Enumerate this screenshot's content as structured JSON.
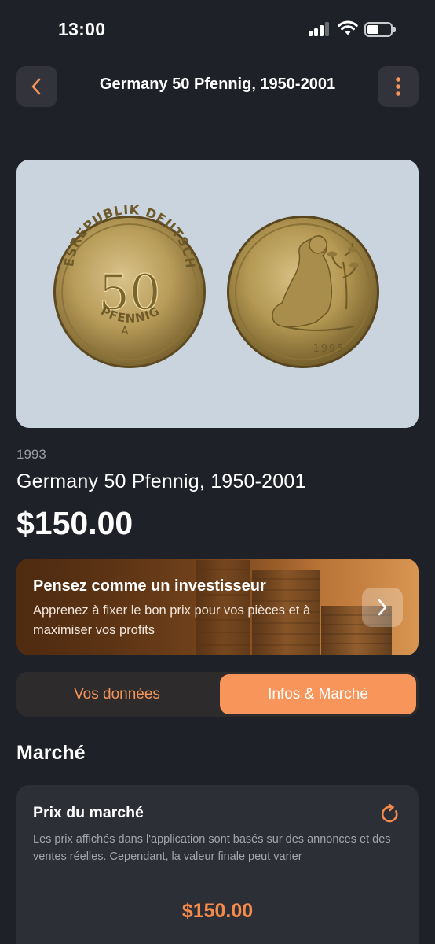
{
  "status_bar": {
    "time": "13:00"
  },
  "header": {
    "title": "Germany 50 Pfennig, 1950-2001",
    "back_icon": "chevron-left-icon",
    "more_icon": "vertical-dots-icon"
  },
  "coin": {
    "obverse_text": "BUNDESREPUBLIK DEUTSCHLAND",
    "obverse_value": "50",
    "obverse_mint": "A",
    "obverse_bottom": "PFENNIG",
    "reverse_year": "1995",
    "year": "1993",
    "name": "Germany 50 Pfennig, 1950-2001",
    "price": "$150.00"
  },
  "promo": {
    "title": "Pensez comme un investisseur",
    "subtitle": "Apprenez à fixer le bon prix pour vos pièces et à maximiser vos profits",
    "arrow_icon": "chevron-right-icon"
  },
  "tabs": {
    "data_label": "Vos données",
    "market_label": "Infos & Marché",
    "active": "market"
  },
  "market": {
    "section_title": "Marché",
    "card_title": "Prix du marché",
    "refresh_icon": "refresh-icon",
    "description": "Les prix affichés dans l'application sont basés sur des annonces et des ventes réelles. Cependant, la valeur finale peut varier",
    "price": "$150.00"
  },
  "colors": {
    "background": "#1f2128",
    "accent": "#f7955a",
    "card": "#2d2f36",
    "price_accent": "#f58a4b"
  }
}
